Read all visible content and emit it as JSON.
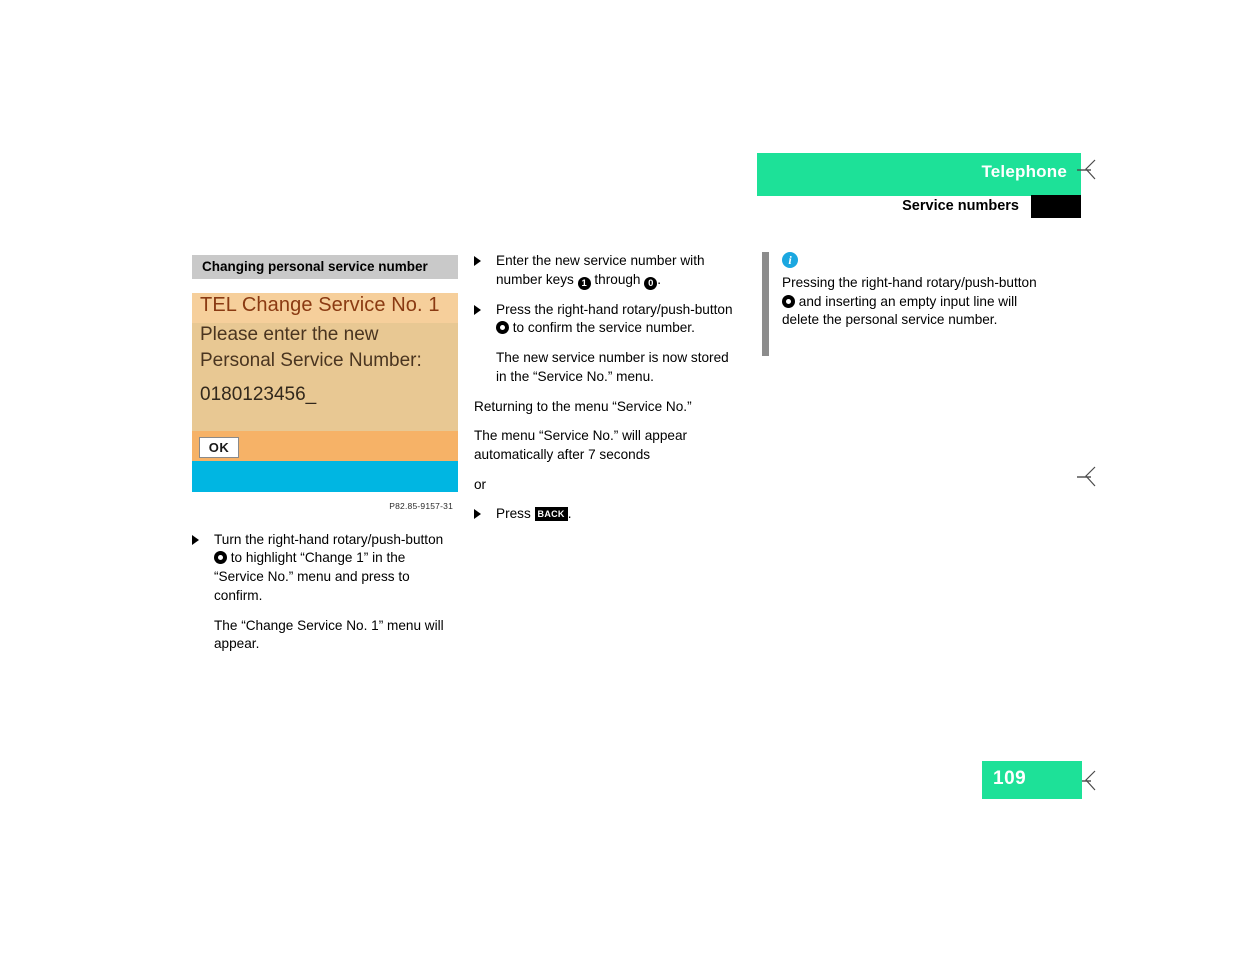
{
  "header": {
    "chapter_title": "Telephone",
    "section_title": "Service numbers",
    "colors": {
      "green": "#1de198",
      "black": "#000000"
    }
  },
  "left_column": {
    "section_heading": "Changing personal service number",
    "illustration": {
      "title": "TEL Change Service No. 1",
      "line1": "Please enter the new",
      "line2": "Personal Service Number:",
      "value": "0180123456_",
      "ok_button": "OK",
      "caption": "P82.85-9157-31",
      "colors": {
        "titlebar": "#f6cf9b",
        "body": "#e8c893",
        "ok_bar": "#f6b267",
        "blue_bar": "#00b6e2"
      }
    },
    "step1": {
      "part1": "Turn the right-hand rotary/push-button",
      "icon": "rotary-push-button-icon",
      "part2": "to highlight “Change 1” in the “Service No.” menu and press to confirm."
    },
    "result1": "The “Change Service No. 1” menu will appear."
  },
  "middle_column": {
    "step1": {
      "part1": "Enter the new service number with number keys",
      "key_first": "1",
      "between": "through",
      "key_last": "0",
      "part2": "."
    },
    "step2": {
      "part1": "Press the right-hand rotary/push-button",
      "icon": "rotary-push-button-icon",
      "part2": "to confirm the service number."
    },
    "result2": "The new service number is now stored in the “Service No.” menu.",
    "subheading": "Returning to the menu “Service No.”",
    "auto_text": "The menu “Service No.” will appear automatically after 7 seconds",
    "or_text": "or",
    "step3": {
      "part1": "Press",
      "button_label": "BACK",
      "part2": "."
    }
  },
  "right_column": {
    "note": {
      "icon": "info-icon",
      "part1": "Pressing the right-hand rotary/push-button",
      "inline_icon": "rotary-push-button-icon",
      "part2": "and inserting an empty input line will delete the personal service number."
    }
  },
  "footer": {
    "page_number": "109"
  }
}
